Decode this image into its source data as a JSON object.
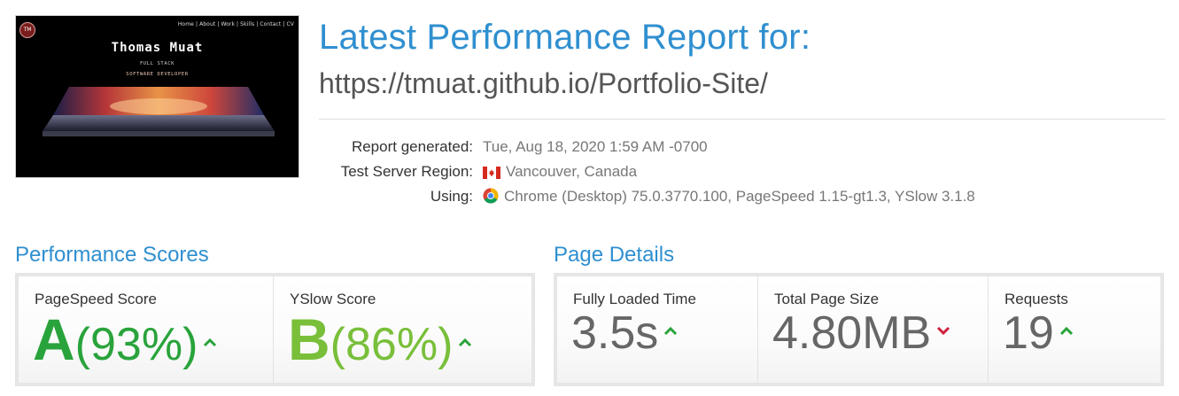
{
  "thumbnail": {
    "logo": "TM",
    "nav": "Home | About | Work | Skills | Contact | CV",
    "name": "Thomas Muat",
    "subtitle_1": "FULL STACK",
    "subtitle_2": "SOFTWARE DEVELOPER"
  },
  "header": {
    "title": "Latest Performance Report for:",
    "url": "https://tmuat.github.io/Portfolio-Site/"
  },
  "meta": {
    "report_generated_label": "Report generated:",
    "report_generated_value": "Tue, Aug 18, 2020 1:59 AM -0700",
    "region_label": "Test Server Region:",
    "region_value": "Vancouver, Canada",
    "region_icon": "canada-flag-icon",
    "using_label": "Using:",
    "using_value": "Chrome (Desktop) 75.0.3770.100, PageSpeed 1.15-gt1.3, YSlow 3.1.8",
    "using_icon": "chrome-icon"
  },
  "performance": {
    "title": "Performance Scores",
    "pagespeed": {
      "label": "PageSpeed Score",
      "grade": "A",
      "percent": "(93%)",
      "trend": "up",
      "color": "#29a33b"
    },
    "yslow": {
      "label": "YSlow Score",
      "grade": "B",
      "percent": "(86%)",
      "trend": "up",
      "color": "#79bf3a"
    }
  },
  "details": {
    "title": "Page Details",
    "load_time": {
      "label": "Fully Loaded Time",
      "value": "3.5s",
      "trend": "up"
    },
    "page_size": {
      "label": "Total Page Size",
      "value": "4.80MB",
      "trend": "down"
    },
    "requests": {
      "label": "Requests",
      "value": "19",
      "trend": "up"
    }
  },
  "colors": {
    "accent": "#2f8fd0",
    "up_arrow": "#29a33b",
    "down_arrow": "#d0213d"
  }
}
